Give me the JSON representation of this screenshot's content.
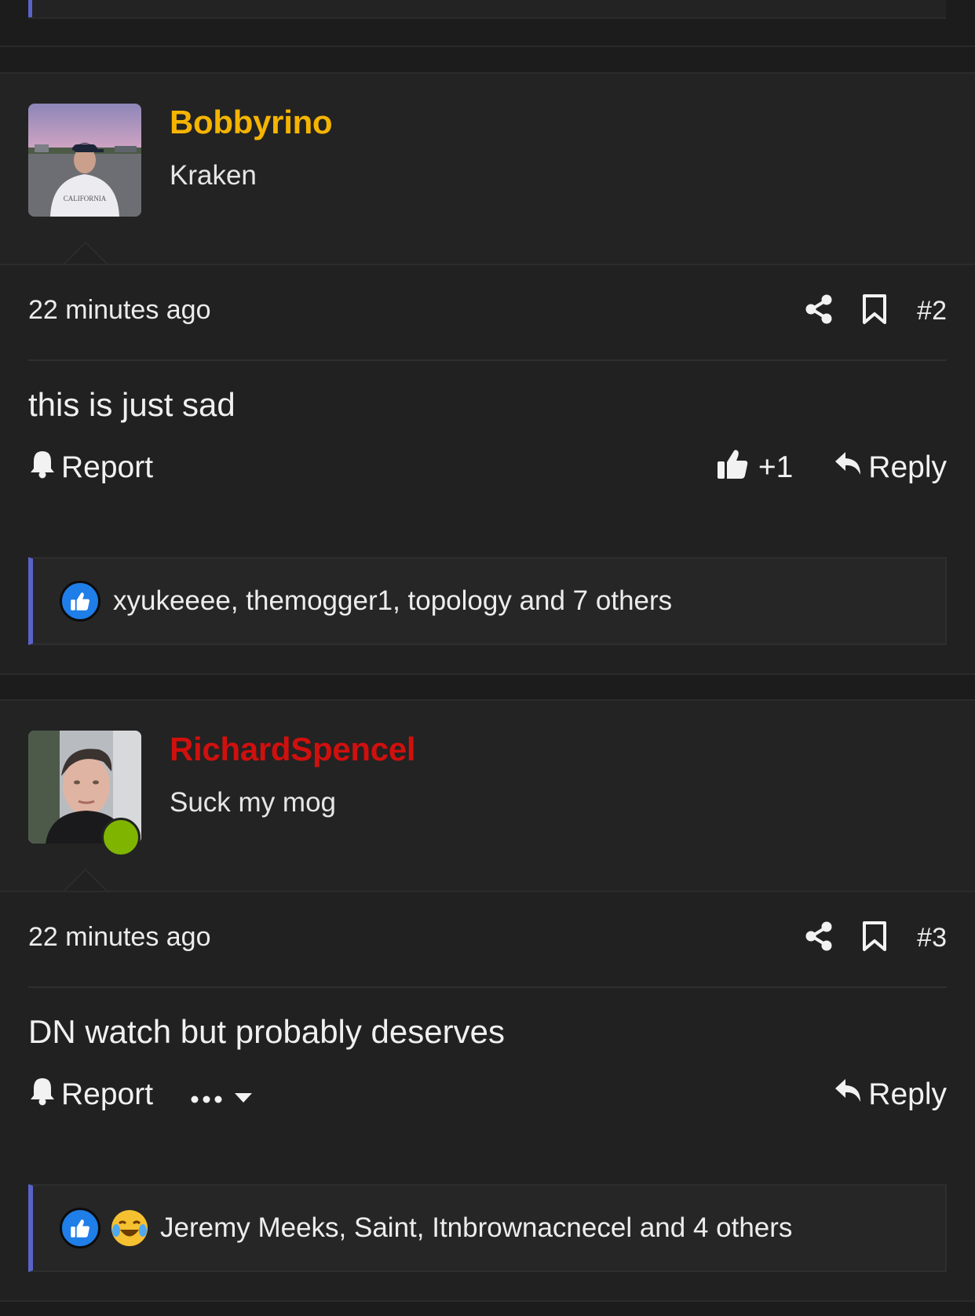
{
  "colors": {
    "accent_bar": "#5a63c8",
    "username_post2": "#f5b400",
    "username_post3": "#d0100d",
    "online": "#7fb500",
    "like_blue": "#1f7ee8"
  },
  "posts": [
    {
      "username": "Bobbyrino",
      "user_title": "Kraken",
      "timestamp": "22 minutes ago",
      "post_number": "#2",
      "message": "this is just sad",
      "report_label": "Report",
      "like_count": "+1",
      "reply_label": "Reply",
      "reactions_text": "xyukeeee, themogger1, topology and 7 others",
      "reaction_icons": [
        "like-icon"
      ]
    },
    {
      "username": "RichardSpencel",
      "user_title": "Suck my mog",
      "timestamp": "22 minutes ago",
      "post_number": "#3",
      "message": "DN watch but probably deserves",
      "report_label": "Report",
      "reply_label": "Reply",
      "online": true,
      "reactions_text": "Jeremy Meeks, Saint, Itnbrownacnecel and 4 others",
      "reaction_icons": [
        "like-icon",
        "laughing-crying-icon"
      ]
    }
  ]
}
